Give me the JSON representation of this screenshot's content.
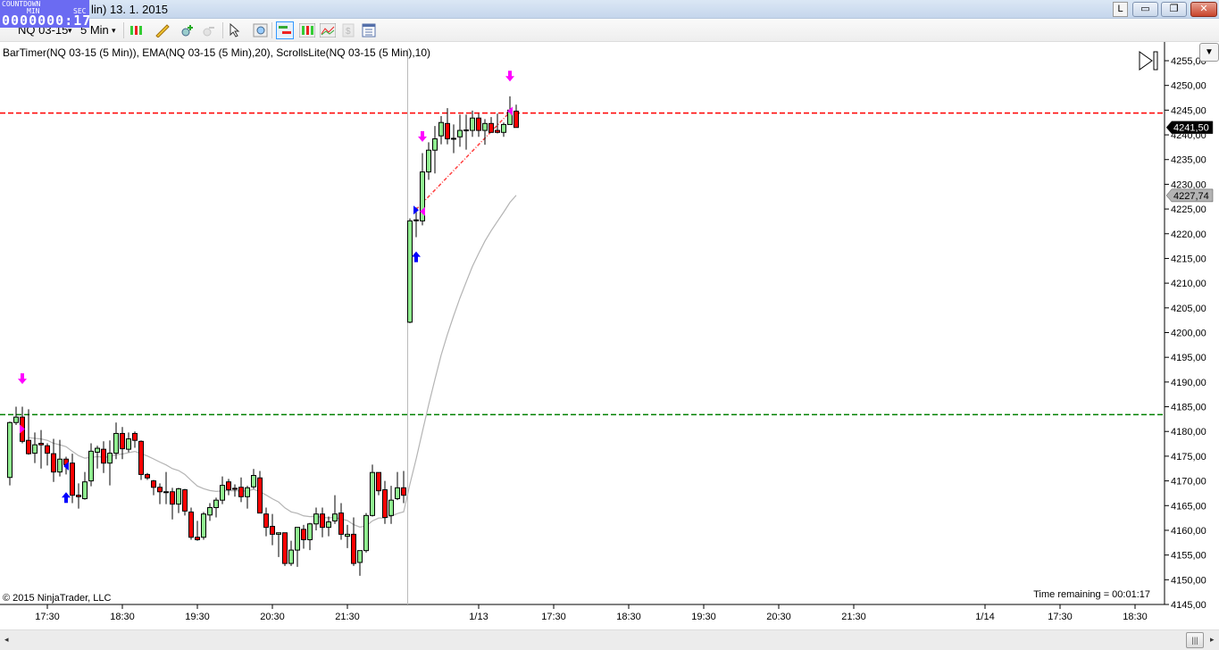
{
  "window": {
    "title": "lin)  13. 1. 2015",
    "btn_l": "L",
    "btn_min": "▭",
    "btn_restore": "❐",
    "btn_close": "✕"
  },
  "countdown": {
    "label": "COUNTDOWN",
    "min_label": "MIN",
    "sec_label": "SEC",
    "value": "0000000:17"
  },
  "toolbar": {
    "instrument": "NQ 03-15",
    "interval": "5 Min",
    "caret": "▾"
  },
  "indicators_label": "BarTimer(NQ 03-15 (5 Min)), EMA(NQ 03-15 (5 Min),20), ScrollsLite(NQ 03-15 (5 Min),10)",
  "copyright": "© 2015 NinjaTrader, LLC",
  "time_remaining": "Time remaining = 00:01:17",
  "colors": {
    "up": "#90ee90",
    "down": "#ff0000",
    "ema": "#b4b4b4",
    "resistance": "#ff0000",
    "support": "#008000",
    "arrow_down": "#ff00ff",
    "arrow_up": "#0000ff"
  },
  "chart_data": {
    "type": "candlestick",
    "instrument": "NQ 03-15 (5 Min)",
    "ylim": [
      4145,
      4255
    ],
    "y_ticks": [
      "4255,00",
      "4250,00",
      "4245,00",
      "4240,00",
      "4235,00",
      "4230,00",
      "4225,00",
      "4220,00",
      "4215,00",
      "4210,00",
      "4205,00",
      "4200,00",
      "4195,00",
      "4190,00",
      "4185,00",
      "4180,00",
      "4175,00",
      "4170,00",
      "4165,00",
      "4160,00",
      "4155,00",
      "4150,00",
      "4145,00"
    ],
    "x_ticks": [
      {
        "label": "17:30",
        "bar": 6
      },
      {
        "label": "18:30",
        "bar": 18
      },
      {
        "label": "19:30",
        "bar": 30
      },
      {
        "label": "20:30",
        "bar": 42
      },
      {
        "label": "21:30",
        "bar": 54
      },
      {
        "label": "1/13",
        "bar": 75
      },
      {
        "label": "17:30",
        "bar": 87
      },
      {
        "label": "18:30",
        "bar": 99
      },
      {
        "label": "19:30",
        "bar": 111
      },
      {
        "label": "20:30",
        "bar": 123
      },
      {
        "label": "21:30",
        "bar": 135
      },
      {
        "label": "1/14",
        "bar": 156
      },
      {
        "label": "17:30",
        "bar": 168
      },
      {
        "label": "18:30",
        "bar": 180
      }
    ],
    "session_break_bar": 63.5,
    "ohlc": [
      [
        4170.7,
        4182,
        4169.1,
        4181.8
      ],
      [
        4181.8,
        4185,
        4181.3,
        4182.9
      ],
      [
        4182.9,
        4185,
        4177.6,
        4178.0
      ],
      [
        4178.2,
        4184.5,
        4175.3,
        4175.5
      ],
      [
        4175.6,
        4179.8,
        4173.6,
        4177.3
      ],
      [
        4177.6,
        4180.3,
        4172.5,
        4177.3
      ],
      [
        4177.1,
        4177.6,
        4173.1,
        4175.6
      ],
      [
        4175.5,
        4178.5,
        4169.8,
        4171.8
      ],
      [
        4171.8,
        4178.3,
        4170.9,
        4174.4
      ],
      [
        4174.4,
        4174.9,
        4171.3,
        4173.3
      ],
      [
        4173.6,
        4175.5,
        4165.5,
        4167.1
      ],
      [
        4167.1,
        4169.5,
        4164.4,
        4166.8
      ],
      [
        4166.4,
        4171.8,
        4166.2,
        4169.8
      ],
      [
        4170,
        4177.6,
        4168.9,
        4176
      ],
      [
        4175.8,
        4177.1,
        4172.5,
        4176.6
      ],
      [
        4176.4,
        4178,
        4171.6,
        4173.6
      ],
      [
        4173.6,
        4178.2,
        4169.1,
        4175.6
      ],
      [
        4175.6,
        4181.8,
        4174.4,
        4179.6
      ],
      [
        4179.6,
        4180.9,
        4174.4,
        4176.5
      ],
      [
        4176.4,
        4179.8,
        4175.8,
        4178.5
      ],
      [
        4179.6,
        4180,
        4176.7,
        4178.2
      ],
      [
        4178,
        4178.2,
        4170.2,
        4171.3
      ],
      [
        4171.3,
        4171.6,
        4170.2,
        4170.6
      ],
      [
        4170,
        4170.2,
        4167.1,
        4168.7
      ],
      [
        4168.7,
        4169.5,
        4165.3,
        4167.8
      ],
      [
        4167.8,
        4171.8,
        4165.3,
        4167.8
      ],
      [
        4167.8,
        4168.6,
        4162.2,
        4165.3
      ],
      [
        4165.3,
        4168.6,
        4163.5,
        4168.4
      ],
      [
        4168.2,
        4168.4,
        4163,
        4163.9
      ],
      [
        4163.7,
        4164.6,
        4158.1,
        4158.6
      ],
      [
        4158.6,
        4161.9,
        4157.9,
        4158.1
      ],
      [
        4158.6,
        4163.7,
        4158.1,
        4163.3
      ],
      [
        4163.1,
        4165.5,
        4161.9,
        4164.6
      ],
      [
        4164.6,
        4166.6,
        4162.6,
        4166.1
      ],
      [
        4166.1,
        4170.9,
        4165.3,
        4169.1
      ],
      [
        4169.8,
        4170.4,
        4167.1,
        4168.2
      ],
      [
        4168.5,
        4169.3,
        4166.8,
        4168.3
      ],
      [
        4168.7,
        4170.7,
        4165.7,
        4166.8
      ],
      [
        4166.8,
        4169,
        4164.4,
        4168.6
      ],
      [
        4168.8,
        4172.4,
        4168.4,
        4171.1
      ],
      [
        4170.6,
        4172,
        4163.5,
        4163.5
      ],
      [
        4163.3,
        4164.6,
        4158.8,
        4160.6
      ],
      [
        4160.8,
        4163.3,
        4157,
        4159.2
      ],
      [
        4159.2,
        4159.5,
        4154.6,
        4159.5
      ],
      [
        4159.5,
        4159.5,
        4152.8,
        4153.3
      ],
      [
        4153.3,
        4157.9,
        4152.8,
        4156
      ],
      [
        4156,
        4160.6,
        4152.6,
        4160.6
      ],
      [
        4160.2,
        4161.1,
        4156.3,
        4158.1
      ],
      [
        4158.1,
        4161.5,
        4156,
        4161.3
      ],
      [
        4161.3,
        4164.6,
        4160,
        4163.3
      ],
      [
        4163.3,
        4164.6,
        4158.6,
        4160.6
      ],
      [
        4160.6,
        4162.8,
        4158.8,
        4161.7
      ],
      [
        4161.9,
        4167.1,
        4161.3,
        4163.3
      ],
      [
        4163.5,
        4165.5,
        4158.1,
        4159.2
      ],
      [
        4158.8,
        4161.1,
        4156.4,
        4159.2
      ],
      [
        4159.2,
        4162.6,
        4152.8,
        4153.3
      ],
      [
        4153.5,
        4155.9,
        4150.8,
        4155.9
      ],
      [
        4155.9,
        4163.5,
        4155.5,
        4163
      ],
      [
        4163,
        4173.3,
        4162.8,
        4171.7
      ],
      [
        4171.7,
        4171.7,
        4167.1,
        4168
      ],
      [
        4168.2,
        4170,
        4161.3,
        4162.6
      ],
      [
        4163,
        4169,
        4161.3,
        4166.1
      ],
      [
        4166.4,
        4171.8,
        4166.1,
        4168.6
      ],
      [
        4168.6,
        4172,
        4165.5,
        4167.1
      ],
      [
        4202.1,
        4223.1,
        4201.9,
        4222.6
      ],
      [
        4222.7,
        4225.3,
        4219.3,
        4222.8
      ],
      [
        4222.6,
        4236.3,
        4221.7,
        4232.5
      ],
      [
        4232.5,
        4238.5,
        4230.9,
        4236.9
      ],
      [
        4236.9,
        4241.8,
        4232.2,
        4239.2
      ],
      [
        4239.8,
        4243.8,
        4238.1,
        4242.5
      ],
      [
        4242.3,
        4245.4,
        4238.1,
        4239.2
      ],
      [
        4239.2,
        4242.1,
        4236.3,
        4239.3
      ],
      [
        4239.6,
        4244.1,
        4237.6,
        4240.9
      ],
      [
        4240.9,
        4244.1,
        4237,
        4241
      ],
      [
        4240.9,
        4244.9,
        4239.6,
        4243.4
      ],
      [
        4243.4,
        4244.3,
        4239.6,
        4240.9
      ],
      [
        4240.9,
        4243.2,
        4238,
        4242.3
      ],
      [
        4242.3,
        4243.6,
        4240.5,
        4240.5
      ],
      [
        4240.9,
        4244.3,
        4240.3,
        4240.5
      ],
      [
        4240.5,
        4242.5,
        4239.6,
        4242.1
      ],
      [
        4242.1,
        4247.8,
        4242.1,
        4245
      ],
      [
        4244.8,
        4246.1,
        4241.5,
        4241.5
      ]
    ],
    "ema_period": 20,
    "ema_seed": 4178.5,
    "ema_start_bar": 3,
    "last_price_label": "4241,50",
    "ema_label": "4227,74",
    "ema_value": 4227.74,
    "resistance_level": 4244.4,
    "support_level": 4183.4,
    "trendline": {
      "from": {
        "bar": 65,
        "price": 4224.9
      },
      "to": {
        "bar": 80,
        "price": 4244.6
      }
    },
    "down_arrows": [
      {
        "bar": 2,
        "price": 4190.5
      },
      {
        "bar": 66,
        "price": 4239.5
      },
      {
        "bar": 80,
        "price": 4251.7
      }
    ],
    "up_arrows": [
      {
        "bar": 9,
        "price": 4166.8
      },
      {
        "bar": 65,
        "price": 4215.5
      }
    ],
    "triangles": [
      {
        "bar": 2,
        "price": 4180.5,
        "color": "#ff00ff",
        "dir": "right"
      },
      {
        "bar": 9,
        "price": 4173.0,
        "color": "#0000ff",
        "dir": "left"
      },
      {
        "bar": 65,
        "price": 4224.8,
        "color": "#0000ff",
        "dir": "right"
      },
      {
        "bar": 66,
        "price": 4224.5,
        "color": "#ff00ff",
        "dir": "left"
      },
      {
        "bar": 80,
        "price": 4244.8,
        "color": "#ff00ff",
        "dir": "left"
      }
    ]
  }
}
